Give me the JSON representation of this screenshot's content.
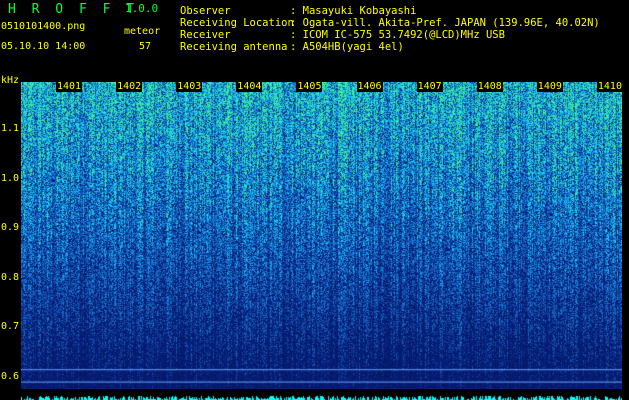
{
  "header": {
    "app_name": "H R O F F T",
    "version": "1.0.0",
    "filename": "0510101400.png",
    "mode_label": "meteor",
    "datetime": "05.10.10 14:00",
    "count": "57"
  },
  "info": [
    {
      "key": "Observer",
      "value": ": Masayuki Kobayashi"
    },
    {
      "key": "Receiving Location",
      "value": ": Ogata-vill. Akita-Pref. JAPAN (139.96E, 40.02N)"
    },
    {
      "key": "Receiver",
      "value": ": ICOM IC-575 53.7492(@LCD)MHz USB"
    },
    {
      "key": "Receiving antenna",
      "value": ": A504HB(yagi 4el)"
    }
  ],
  "axis": {
    "unit": "kHz",
    "y_labels": [
      "1.1",
      "1.0",
      "0.9",
      "0.8",
      "0.7",
      "0.6"
    ],
    "y_values": [
      1.1,
      1.0,
      0.9,
      0.8,
      0.7,
      0.6
    ],
    "y_range": [
      0.575,
      1.195
    ],
    "time_labels": [
      "1401",
      "1402",
      "1403",
      "1404",
      "1405",
      "1406",
      "1407",
      "1408",
      "1409",
      "1410"
    ]
  },
  "colors": {
    "background": "#000000",
    "text": "#ffff00",
    "title": "#00ff33",
    "spectrum_low": "#0a1a80",
    "spectrum_high": "#33ff66",
    "baseline": "#00ffff"
  }
}
